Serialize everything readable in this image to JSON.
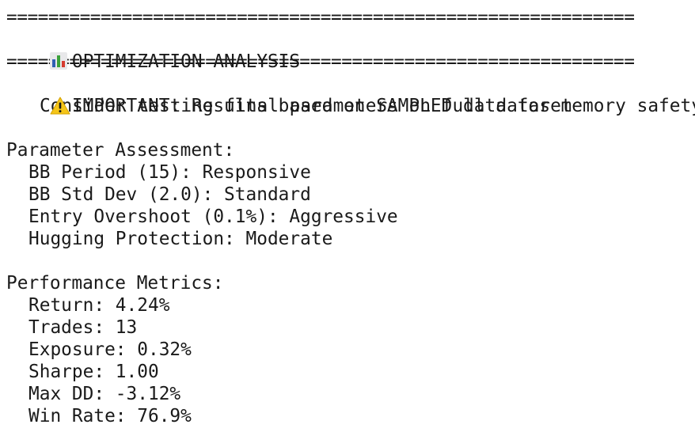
{
  "terminal": {
    "rule": "============================================================",
    "title": {
      "icon": "bar-chart-icon",
      "text": "OPTIMIZATION ANALYSIS"
    },
    "warning": {
      "icon": "warning-icon",
      "line1": "IMPORTANT: Results based on SAMPLED data for memory safety",
      "line2": "Consider testing final parameters on full dataset"
    },
    "parameter_assessment": {
      "heading": "Parameter Assessment:",
      "items": [
        "BB Period (15): Responsive",
        "BB Std Dev (2.0): Standard",
        "Entry Overshoot (0.1%): Aggressive",
        "Hugging Protection: Moderate"
      ]
    },
    "performance_metrics": {
      "heading": "Performance Metrics:",
      "items": [
        "Return: 4.24%",
        "Trades: 13",
        "Exposure: 0.32%",
        "Sharpe: 1.00",
        "Max DD: -3.12%",
        "Win Rate: 76.9%"
      ]
    },
    "colors": {
      "text": "#1a1a1a",
      "background": "#ffffff",
      "warning_yellow": "#f5c518",
      "bar_blue": "#2f5fb3",
      "bar_green": "#3aa13a",
      "bar_red": "#d63b2f"
    }
  }
}
